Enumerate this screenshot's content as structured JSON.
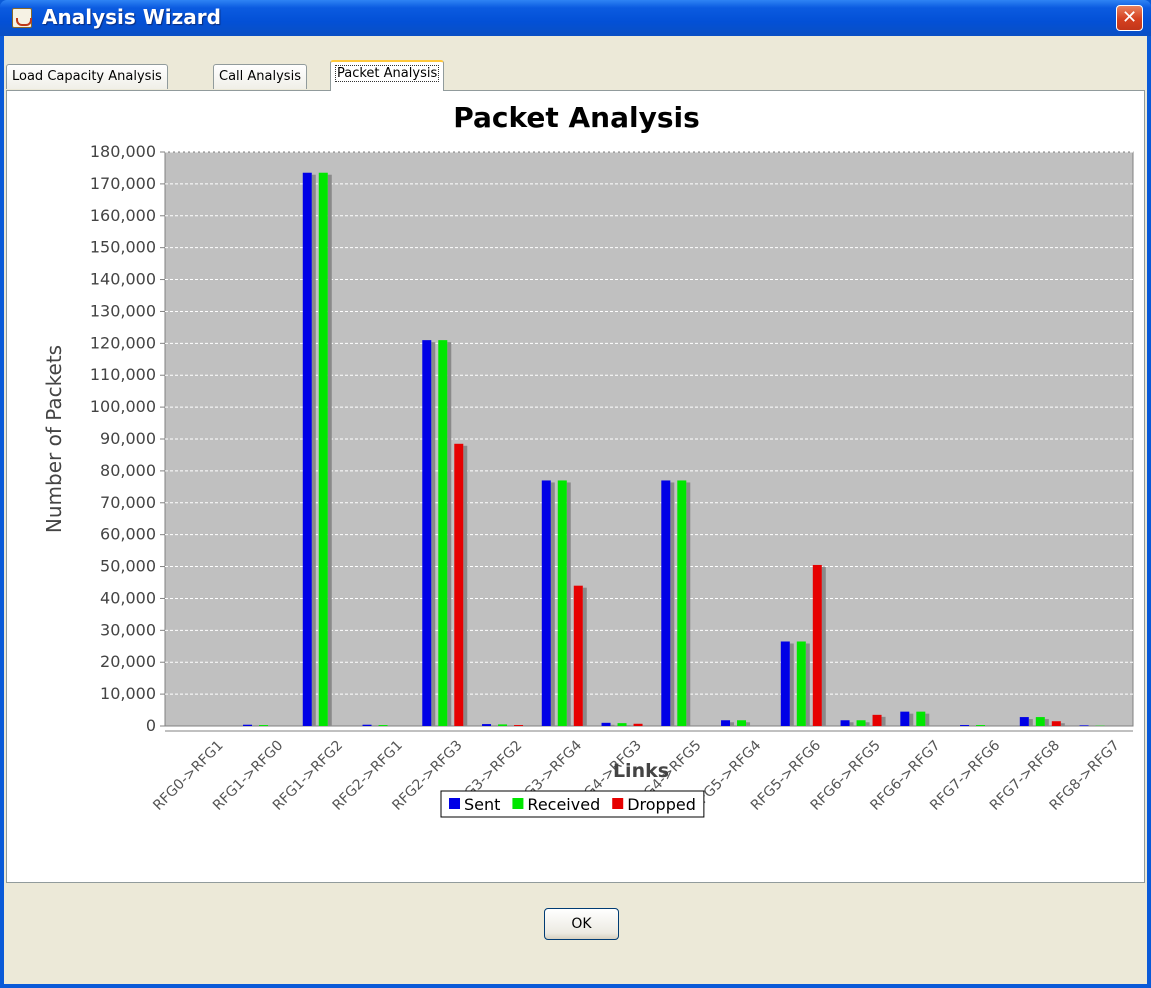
{
  "window": {
    "title": "Analysis Wizard",
    "close_label": "✕",
    "app_icon": "java-cup-icon"
  },
  "tabs": [
    {
      "label": "Load Capacity Analysis",
      "active": false
    },
    {
      "label": "Call Analysis",
      "active": false
    },
    {
      "label": "Packet Analysis",
      "active": true
    }
  ],
  "footer": {
    "ok_label": "OK"
  },
  "chart_data": {
    "type": "bar",
    "title": "Packet Analysis",
    "xlabel": "Links",
    "ylabel": "Number of Packets",
    "ylim": [
      0,
      180000
    ],
    "yticks": [
      "0",
      "10,000",
      "20,000",
      "30,000",
      "40,000",
      "50,000",
      "60,000",
      "70,000",
      "80,000",
      "90,000",
      "100,000",
      "110,000",
      "120,000",
      "130,000",
      "140,000",
      "150,000",
      "160,000",
      "170,000",
      "180,000"
    ],
    "grid": true,
    "legend_position": "bottom",
    "categories": [
      "RFG0->RFG1",
      "RFG1->RFG0",
      "RFG1->RFG2",
      "RFG2->RFG1",
      "RFG2->RFG3",
      "RFG3->RFG2",
      "RFG3->RFG4",
      "RFG4->RFG3",
      "RFG4->RFG5",
      "RFG5->RFG4",
      "RFG5->RFG6",
      "RFG6->RFG5",
      "RFG6->RFG7",
      "RFG7->RFG6",
      "RFG7->RFG8",
      "RFG8->RFG7"
    ],
    "series": [
      {
        "name": "Sent",
        "color": "#0000e6",
        "values": [
          0,
          400,
          173500,
          400,
          121000,
          600,
          77000,
          1000,
          77000,
          1800,
          26500,
          1800,
          4500,
          300,
          2800,
          200
        ]
      },
      {
        "name": "Received",
        "color": "#00e600",
        "values": [
          0,
          300,
          173500,
          300,
          121000,
          500,
          77000,
          900,
          77000,
          1800,
          26500,
          1800,
          4500,
          300,
          2800,
          100
        ]
      },
      {
        "name": "Dropped",
        "color": "#e60000",
        "values": [
          0,
          0,
          0,
          0,
          88500,
          300,
          44000,
          700,
          0,
          0,
          50500,
          3500,
          0,
          0,
          1500,
          0
        ]
      }
    ],
    "plot_background": "#c0c0c0"
  }
}
